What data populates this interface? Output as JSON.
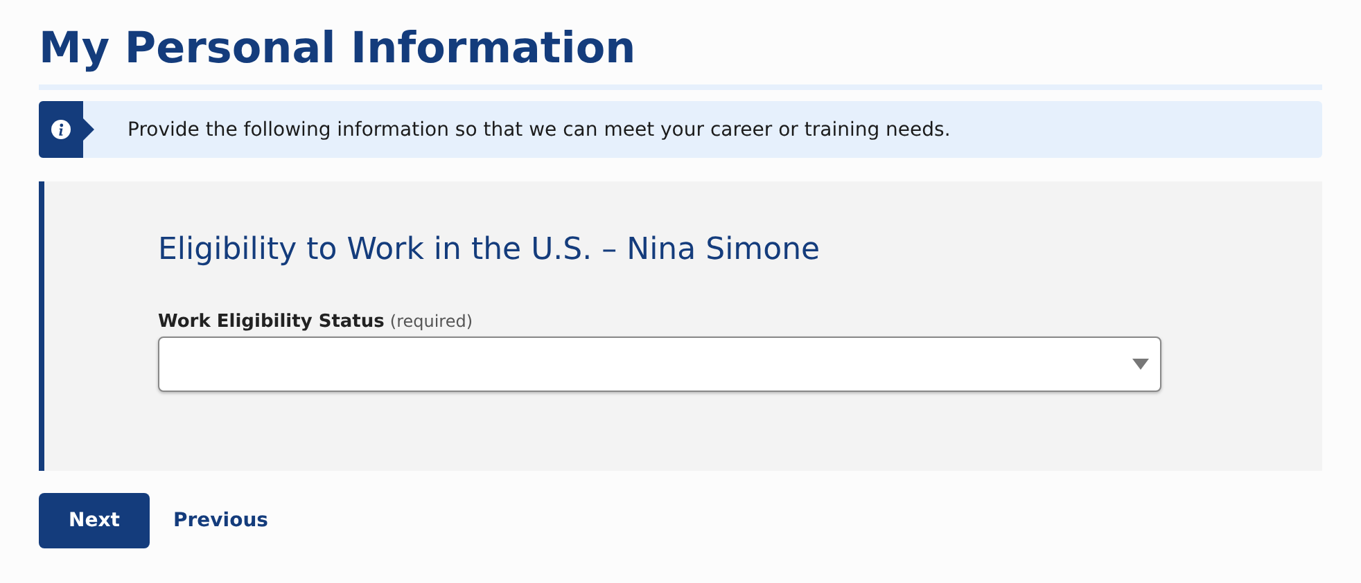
{
  "page_title": "My Personal Information",
  "info_banner": {
    "text": "Provide the following information so that we can meet your career or training needs."
  },
  "section": {
    "heading": "Eligibility to Work in the U.S. – Nina Simone",
    "field": {
      "label": "Work Eligibility Status",
      "hint": "(required)"
    }
  },
  "buttons": {
    "primary": "Next",
    "secondary": "Previous"
  }
}
